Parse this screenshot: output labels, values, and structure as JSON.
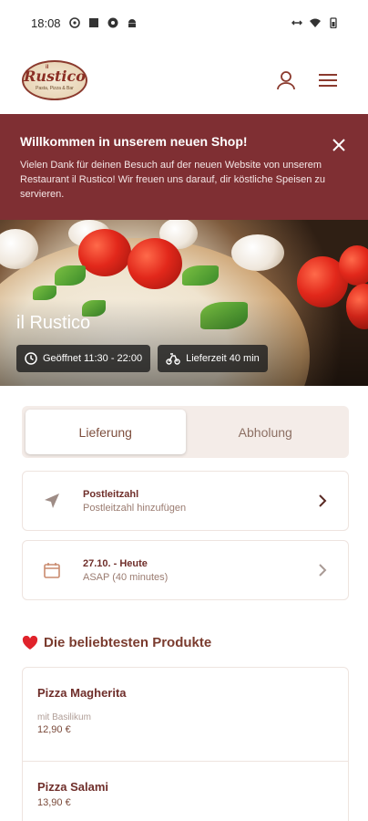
{
  "statusbar": {
    "time": "18:08"
  },
  "header": {
    "logo_text": "Rustico",
    "logo_prefix": "il",
    "logo_tagline": "Pasta, Pizza & Bar"
  },
  "banner": {
    "title": "Willkommen in unserem neuen Shop!",
    "text": "Vielen Dank für deinen Besuch auf der neuen Website von unserem Restaurant il Rustico! Wir freuen uns darauf, dir köstliche Speisen zu servieren."
  },
  "hero": {
    "name": "il Rustico",
    "opening": "Geöffnet 11:30 - 22:00",
    "delivery_time": "Lieferzeit 40 min"
  },
  "order_mode": {
    "tabs": [
      {
        "label": "Lieferung",
        "active": true
      },
      {
        "label": "Abholung",
        "active": false
      }
    ]
  },
  "postcode": {
    "title": "Postleitzahl",
    "subtitle": "Postleitzahl hinzufügen"
  },
  "schedule": {
    "title": "27.10. - Heute",
    "subtitle": "ASAP (40 minutes)"
  },
  "popular": {
    "title": "Die beliebtesten Produkte",
    "products": [
      {
        "name": "Pizza Magherita",
        "description": "mit Basilikum",
        "price": "12,90 €"
      },
      {
        "name": "Pizza Salami",
        "price": "13,90 €"
      }
    ]
  },
  "colors": {
    "brand": "#7f2f33",
    "accent_text": "#6f2e2a"
  }
}
